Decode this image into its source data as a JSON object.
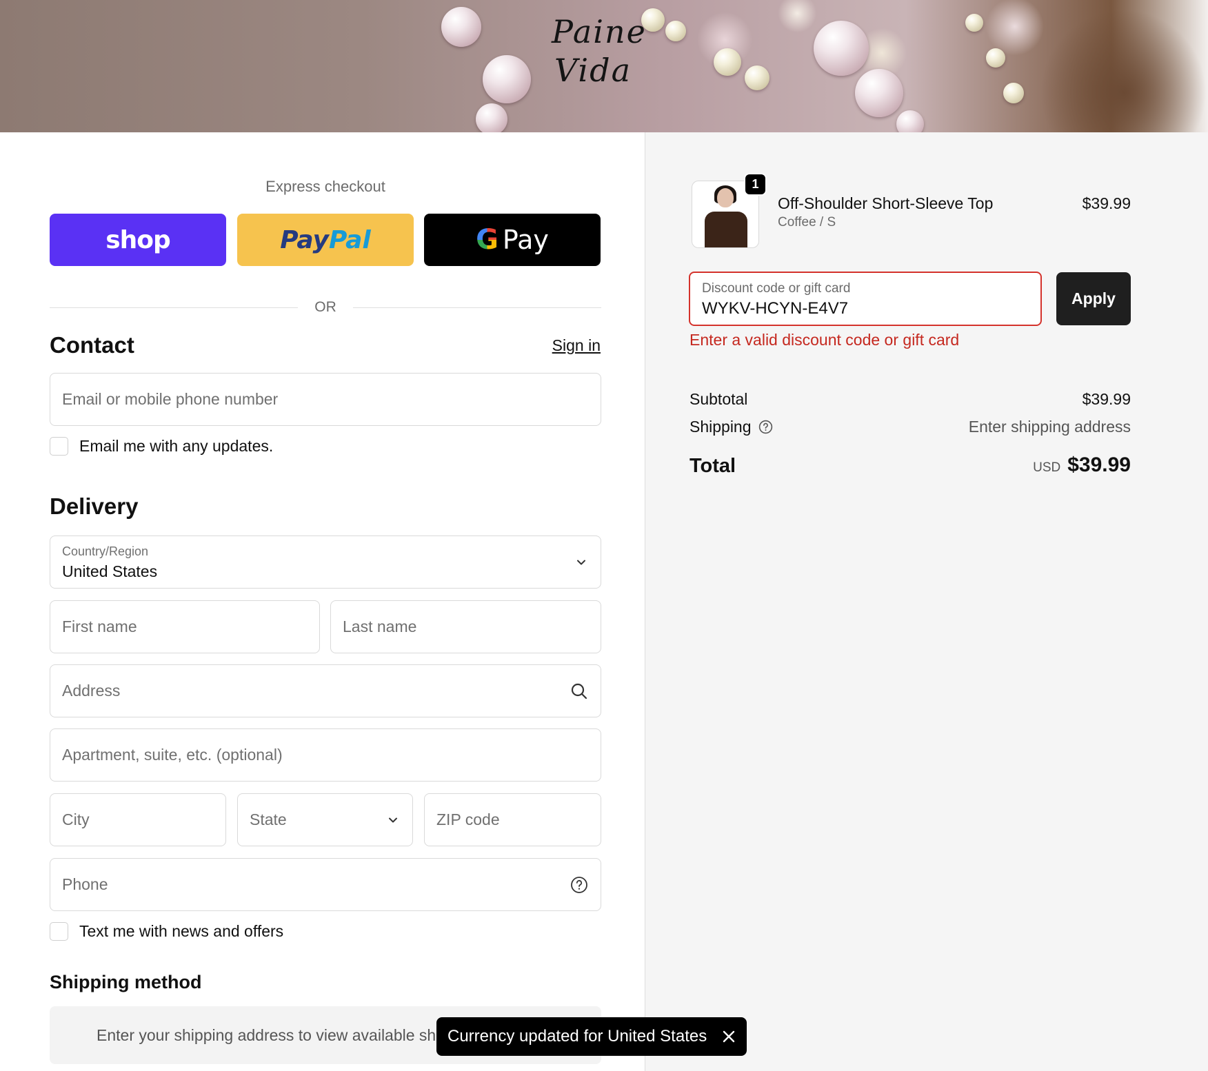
{
  "header": {
    "logo_line1": "Paine",
    "logo_line2": "Vida"
  },
  "express": {
    "title": "Express checkout",
    "shop_label": "shop",
    "paypal_part1": "Pay",
    "paypal_part2": "Pal",
    "gpay_g": "G",
    "gpay_label": "Pay",
    "or_label": "OR"
  },
  "contact": {
    "heading": "Contact",
    "sign_in": "Sign in",
    "email_placeholder": "Email or mobile phone number",
    "email_updates_label": "Email me with any updates."
  },
  "delivery": {
    "heading": "Delivery",
    "country_label": "Country/Region",
    "country_value": "United States",
    "first_name_placeholder": "First name",
    "last_name_placeholder": "Last name",
    "address_placeholder": "Address",
    "apartment_placeholder": "Apartment, suite, etc. (optional)",
    "city_placeholder": "City",
    "state_placeholder": "State",
    "zip_placeholder": "ZIP code",
    "phone_placeholder": "Phone",
    "text_offers_label": "Text me with news and offers"
  },
  "shipping_method": {
    "heading": "Shipping method",
    "message": "Enter your shipping address to view available sh"
  },
  "toast": {
    "message": "Currency updated for United States"
  },
  "order": {
    "item": {
      "quantity": "1",
      "name": "Off-Shoulder Short-Sleeve Top",
      "variant": "Coffee / S",
      "price": "$39.99"
    },
    "discount": {
      "label": "Discount code or gift card",
      "value": "WYKV-HCYN-E4V7",
      "apply_label": "Apply",
      "error": "Enter a valid discount code or gift card"
    },
    "subtotal_label": "Subtotal",
    "subtotal_value": "$39.99",
    "shipping_label": "Shipping",
    "shipping_value": "Enter shipping address",
    "total_label": "Total",
    "total_currency": "USD",
    "total_value": "$39.99"
  },
  "colors": {
    "shop_purple": "#5a31f4",
    "paypal_yellow": "#f6c34e",
    "error_red": "#c5281f",
    "dark_button": "#1f1f1f"
  },
  "icons": [
    "chevron-down-icon",
    "search-icon",
    "help-circle-icon",
    "close-icon"
  ]
}
